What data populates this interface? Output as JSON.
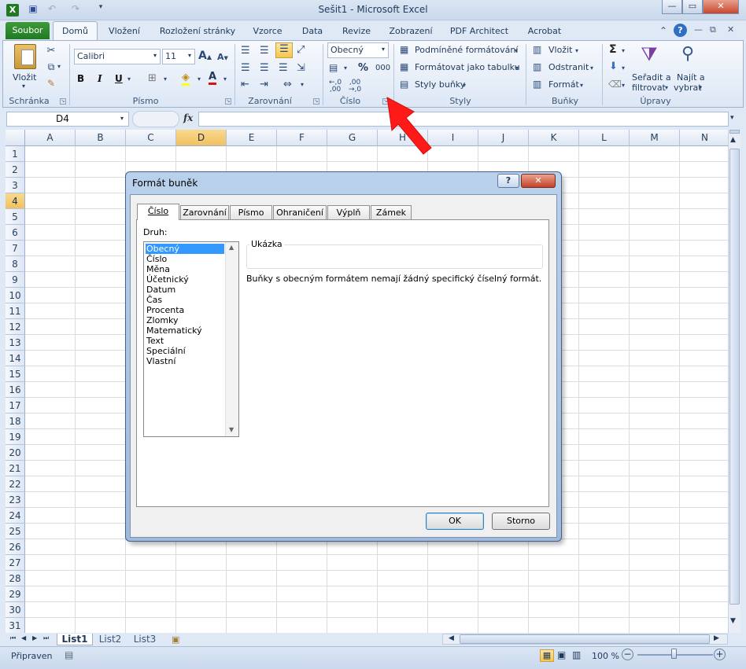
{
  "window": {
    "title": "Sešit1  -  Microsoft Excel"
  },
  "quick_access": [
    "excel-logo-icon",
    "save-icon",
    "undo-icon",
    "redo-icon",
    "customize-icon"
  ],
  "tabs": [
    "Soubor",
    "Domů",
    "Vložení",
    "Rozložení stránky",
    "Vzorce",
    "Data",
    "Revize",
    "Zobrazení",
    "PDF Architect",
    "Acrobat"
  ],
  "ribbon": {
    "clipboard": {
      "paste": "Vložit",
      "label": "Schránka"
    },
    "font": {
      "name": "Calibri",
      "size": "11",
      "label": "Písmo"
    },
    "alignment": {
      "label": "Zarovnání"
    },
    "number": {
      "format": "Obecný",
      "percent": "%",
      "thousands": "000",
      "label": "Číslo"
    },
    "styles": {
      "conditional": "Podmíněné formátování",
      "as_table": "Formátovat jako tabulku",
      "cell_styles": "Styly buňky",
      "label": "Styly"
    },
    "cells": {
      "insert": "Vložit",
      "delete": "Odstranit",
      "format": "Formát",
      "label": "Buňky"
    },
    "editing": {
      "sort_line1": "Seřadit a",
      "sort_line2": "filtrovat",
      "find_line1": "Najít a",
      "find_line2": "vybrat",
      "label": "Úpravy"
    }
  },
  "formula_bar": {
    "name_box": "D4",
    "fx": "fx",
    "value": ""
  },
  "grid": {
    "columns": [
      "A",
      "B",
      "C",
      "D",
      "E",
      "F",
      "G",
      "H",
      "I",
      "J",
      "K",
      "L",
      "M",
      "N"
    ],
    "rows": [
      "1",
      "2",
      "3",
      "4",
      "5",
      "6",
      "7",
      "8",
      "9",
      "10",
      "11",
      "12",
      "13",
      "14",
      "15",
      "16",
      "17",
      "18",
      "19",
      "20",
      "21",
      "22",
      "23",
      "24",
      "25",
      "26",
      "27",
      "28",
      "29",
      "30",
      "31"
    ],
    "selected_cell": "D4"
  },
  "sheets": {
    "tabs": [
      "List1",
      "List2",
      "List3"
    ],
    "active": "List1"
  },
  "status": {
    "ready": "Připraven",
    "zoom": "100 %"
  },
  "dialog": {
    "title": "Formát buněk",
    "help": "?",
    "close": "✕",
    "tabs": [
      "Číslo",
      "Zarovnání",
      "Písmo",
      "Ohraničení",
      "Výplň",
      "Zámek"
    ],
    "active_tab": "Číslo",
    "category_label": "Druh:",
    "categories": [
      "Obecný",
      "Číslo",
      "Měna",
      "Účetnický",
      "Datum",
      "Čas",
      "Procenta",
      "Zlomky",
      "Matematický",
      "Text",
      "Speciální",
      "Vlastní"
    ],
    "selected_category": "Obecný",
    "sample_label": "Ukázka",
    "description": "Buňky s obecným formátem nemají žádný specifický číselný formát.",
    "ok": "OK",
    "cancel": "Storno"
  },
  "colors": {
    "accent": "#1f7a23",
    "selection": "#f1c15f",
    "arrow": "#ff1a1a",
    "list_selection": "#3399ff"
  }
}
